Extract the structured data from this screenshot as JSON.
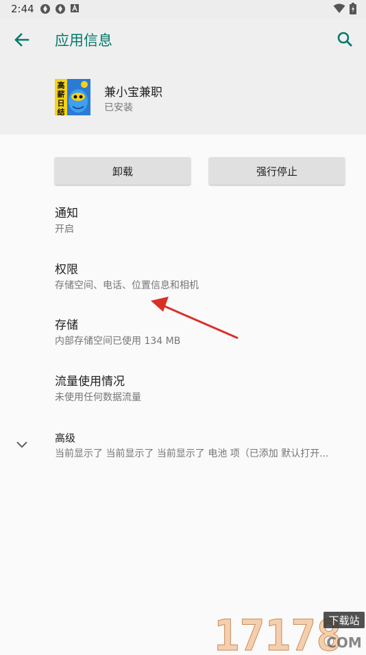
{
  "status_bar": {
    "time": "2:44",
    "left_icons": [
      "aperture-icon",
      "aperture-icon",
      "a-badge-icon"
    ],
    "right_icons": [
      "wifi-icon",
      "battery-icon"
    ]
  },
  "header": {
    "title": "应用信息",
    "accent_color": "#00796b",
    "back_icon": "arrow-left-icon",
    "search_icon": "search-icon"
  },
  "app": {
    "name": "兼小宝兼职",
    "status": "已安装",
    "icon_text": [
      "高",
      "薪",
      "日",
      "结"
    ]
  },
  "buttons": {
    "uninstall": "卸载",
    "force_stop": "强行停止"
  },
  "prefs": [
    {
      "title": "通知",
      "summary": "开启"
    },
    {
      "title": "权限",
      "summary": "存储空间、电话、位置信息和相机"
    },
    {
      "title": "存储",
      "summary": "内部存储空间已使用 134 MB"
    },
    {
      "title": "流量使用情况",
      "summary": "未使用任何数据流量"
    },
    {
      "title": "高级",
      "summary": "当前显示了 当前显示了 当前显示了 电池 项（已添加 默认打开..."
    }
  ],
  "watermark": {
    "number": "17178",
    "tag": "下载站",
    "domain": "COM"
  }
}
